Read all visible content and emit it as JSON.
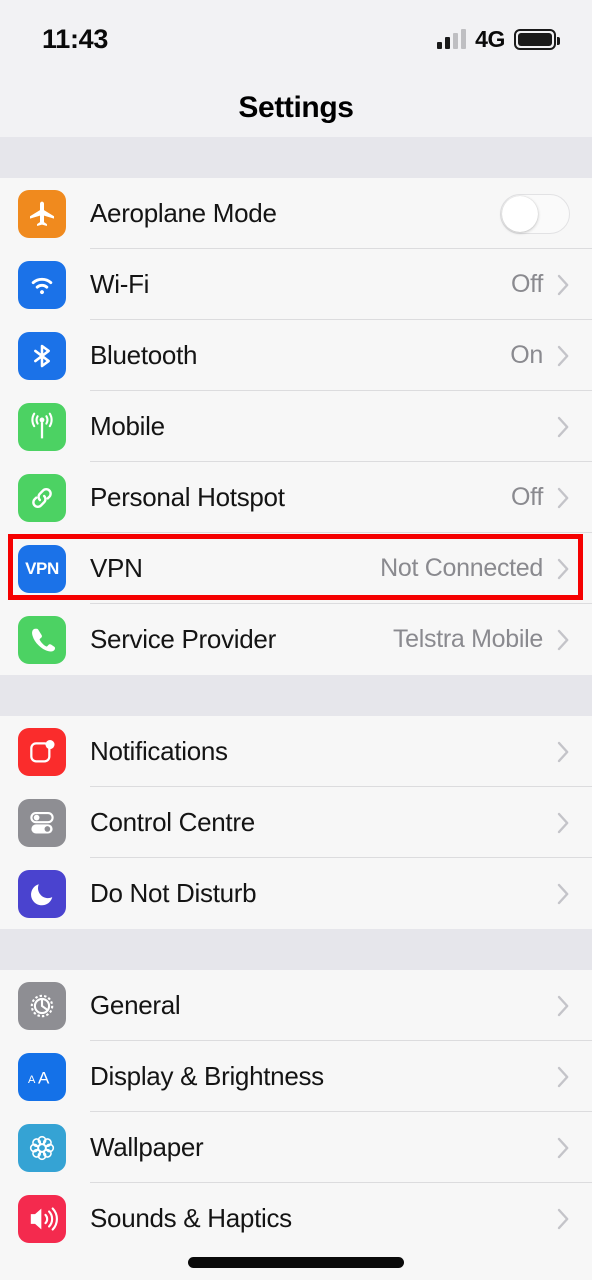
{
  "status_bar": {
    "time": "11:43",
    "network": "4G",
    "signal_icon": "cellular-signal-icon",
    "battery_icon": "battery-full-icon"
  },
  "nav": {
    "title": "Settings"
  },
  "highlight": {
    "color": "#F50000",
    "target": "VPN"
  },
  "colors": {
    "aeroplane": "#F08A1E",
    "wifi": "#1B72E8",
    "bluetooth": "#1B72E8",
    "mobile": "#4CD263",
    "hotspot": "#4CD263",
    "vpn": "#1B72E8",
    "service_provider": "#4CD263",
    "notifications": "#FA2C2C",
    "control_centre": "#8E8E93",
    "do_not_disturb": "#4A43CF",
    "general": "#8E8E93",
    "display": "#1471E8",
    "wallpaper": "#35A3D4",
    "sounds": "#F42A4E",
    "value_text": "#8A8A8F",
    "chevron": "#C4C4C9"
  },
  "groups": [
    {
      "rows": [
        {
          "icon": "aeroplane-icon",
          "label": "Aeroplane Mode",
          "value": "",
          "control": "toggle",
          "toggle_on": false
        },
        {
          "icon": "wifi-icon",
          "label": "Wi-Fi",
          "value": "Off",
          "control": "chevron"
        },
        {
          "icon": "bluetooth-icon",
          "label": "Bluetooth",
          "value": "On",
          "control": "chevron"
        },
        {
          "icon": "mobile-icon",
          "label": "Mobile",
          "value": "",
          "control": "chevron"
        },
        {
          "icon": "personal-hotspot-icon",
          "label": "Personal Hotspot",
          "value": "Off",
          "control": "chevron"
        },
        {
          "icon": "vpn-icon",
          "label": "VPN",
          "value": "Not Connected",
          "control": "chevron"
        },
        {
          "icon": "service-provider-icon",
          "label": "Service Provider",
          "value": "Telstra Mobile",
          "control": "chevron"
        }
      ]
    },
    {
      "rows": [
        {
          "icon": "notifications-icon",
          "label": "Notifications",
          "value": "",
          "control": "chevron"
        },
        {
          "icon": "control-centre-icon",
          "label": "Control Centre",
          "value": "",
          "control": "chevron"
        },
        {
          "icon": "do-not-disturb-icon",
          "label": "Do Not Disturb",
          "value": "",
          "control": "chevron"
        }
      ]
    },
    {
      "rows": [
        {
          "icon": "general-icon",
          "label": "General",
          "value": "",
          "control": "chevron"
        },
        {
          "icon": "display-brightness-icon",
          "label": "Display & Brightness",
          "value": "",
          "control": "chevron"
        },
        {
          "icon": "wallpaper-icon",
          "label": "Wallpaper",
          "value": "",
          "control": "chevron"
        },
        {
          "icon": "sounds-haptics-icon",
          "label": "Sounds & Haptics",
          "value": "",
          "control": "chevron"
        }
      ]
    }
  ]
}
